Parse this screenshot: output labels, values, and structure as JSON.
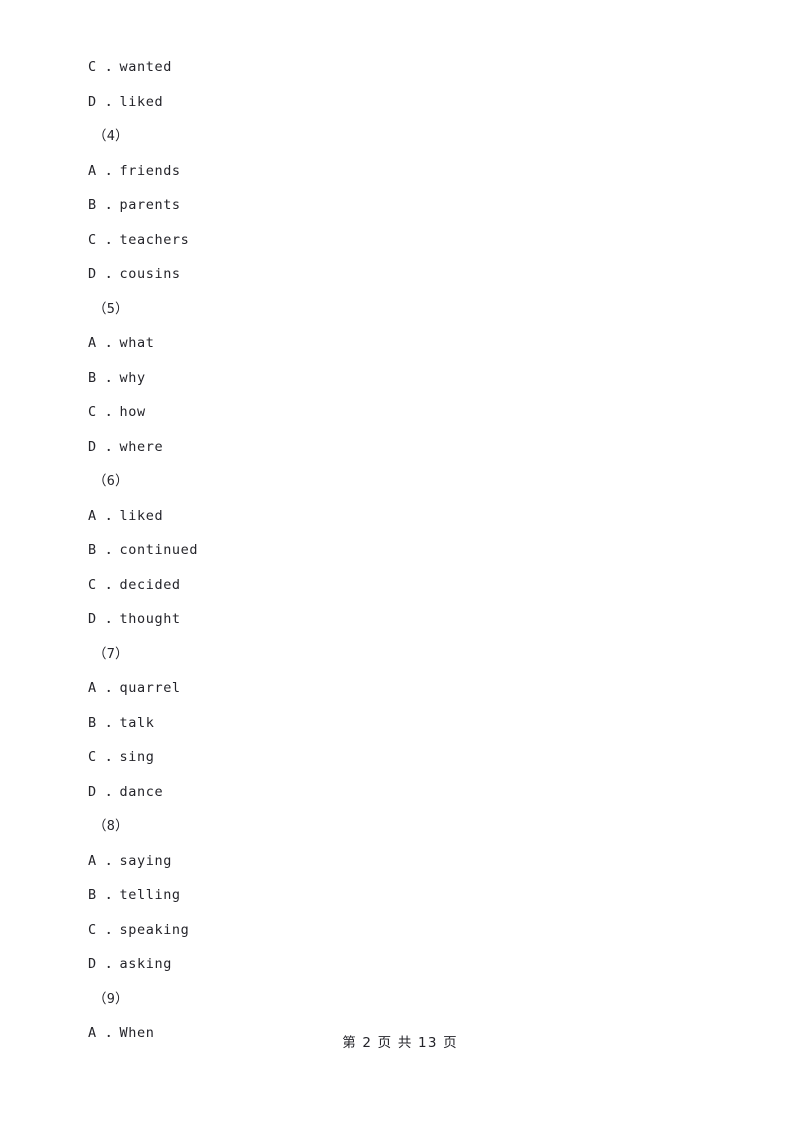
{
  "document": {
    "type": "exam-paper-page",
    "background_color": "#ffffff",
    "text_color": "#24242a"
  },
  "body_lines": [
    {
      "kind": "option",
      "text": "C ．wanted"
    },
    {
      "kind": "option",
      "text": "D ．liked"
    },
    {
      "kind": "qnum",
      "text": "（4）"
    },
    {
      "kind": "option",
      "text": "A ．friends"
    },
    {
      "kind": "option",
      "text": "B ．parents"
    },
    {
      "kind": "option",
      "text": "C ．teachers"
    },
    {
      "kind": "option",
      "text": "D ．cousins"
    },
    {
      "kind": "qnum",
      "text": "（5）"
    },
    {
      "kind": "option",
      "text": "A ．what"
    },
    {
      "kind": "option",
      "text": "B ．why"
    },
    {
      "kind": "option",
      "text": "C ．how"
    },
    {
      "kind": "option",
      "text": "D ．where"
    },
    {
      "kind": "qnum",
      "text": "（6）"
    },
    {
      "kind": "option",
      "text": "A ．liked"
    },
    {
      "kind": "option",
      "text": "B ．continued"
    },
    {
      "kind": "option",
      "text": "C ．decided"
    },
    {
      "kind": "option",
      "text": "D ．thought"
    },
    {
      "kind": "qnum",
      "text": "（7）"
    },
    {
      "kind": "option",
      "text": "A ．quarrel"
    },
    {
      "kind": "option",
      "text": "B ．talk"
    },
    {
      "kind": "option",
      "text": "C ．sing"
    },
    {
      "kind": "option",
      "text": "D ．dance"
    },
    {
      "kind": "qnum",
      "text": "（8）"
    },
    {
      "kind": "option",
      "text": "A ．saying"
    },
    {
      "kind": "option",
      "text": "B ．telling"
    },
    {
      "kind": "option",
      "text": "C ．speaking"
    },
    {
      "kind": "option",
      "text": "D ．asking"
    },
    {
      "kind": "qnum",
      "text": "（9）"
    },
    {
      "kind": "option",
      "text": "A ．When"
    }
  ],
  "footer": {
    "text": "第 2 页 共 13 页",
    "current_page": 2,
    "total_pages": 13
  }
}
